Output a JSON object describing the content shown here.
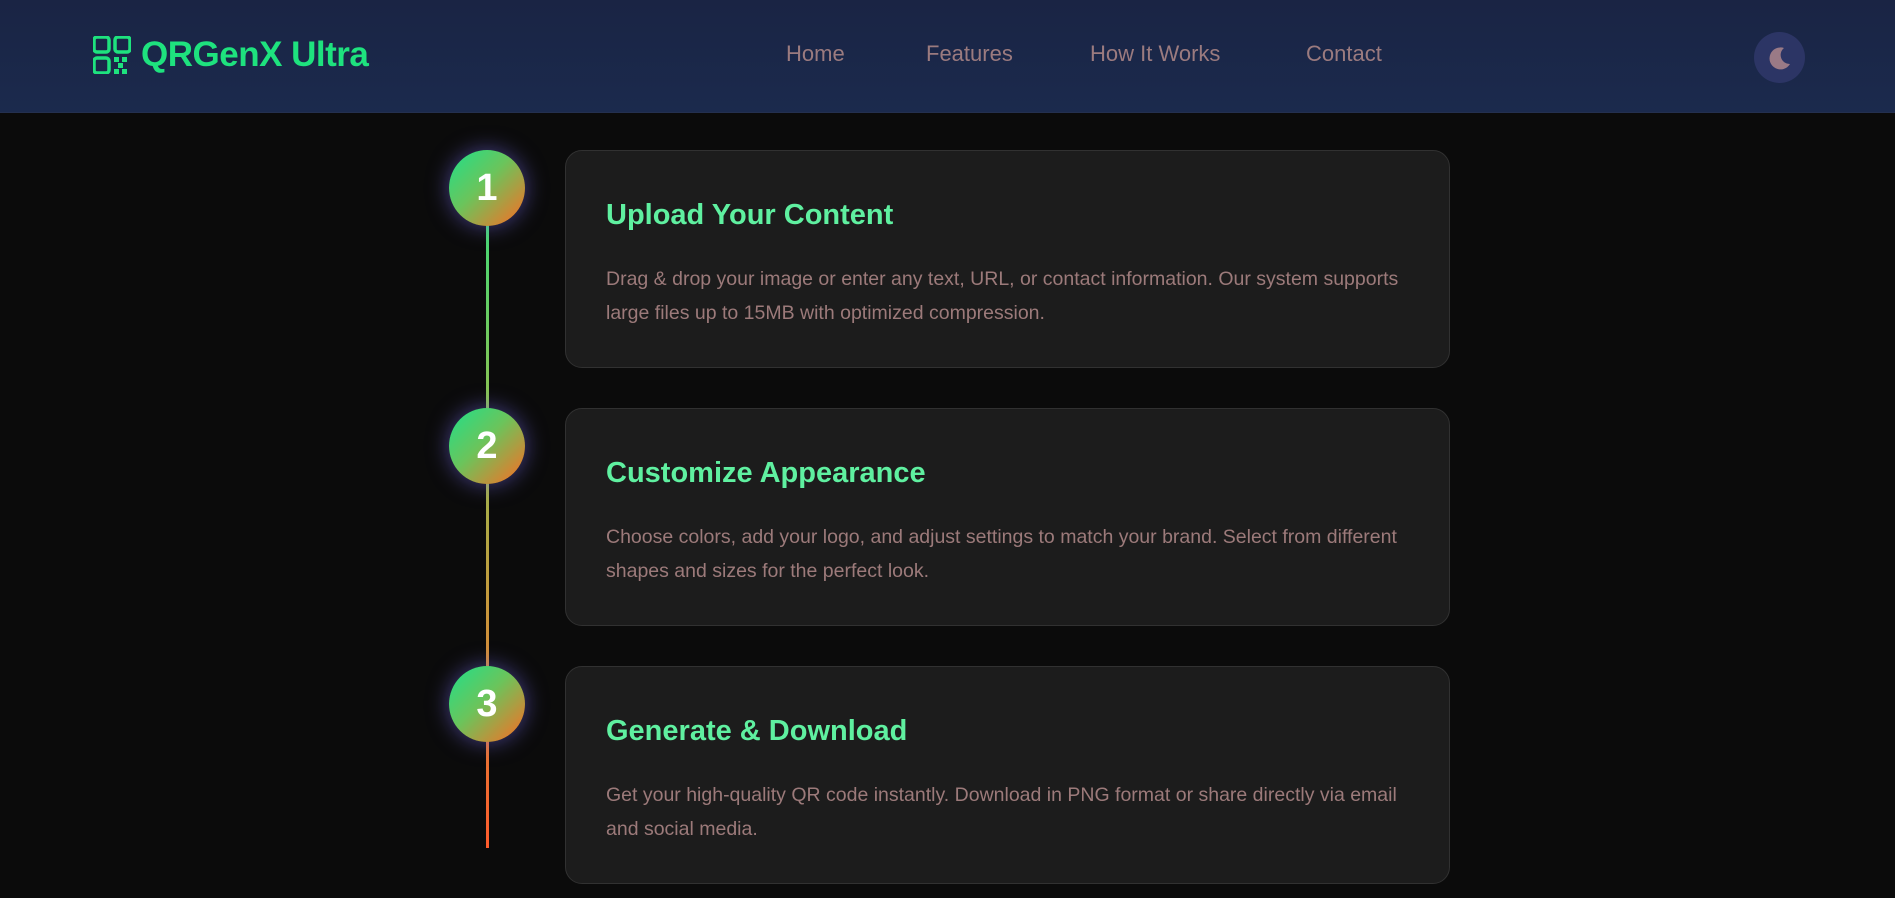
{
  "brand": {
    "name": "QRGenX Ultra",
    "icon": "qr-code-icon",
    "color": "#1ee27e"
  },
  "nav": {
    "links": [
      "Home",
      "Features",
      "How It Works",
      "Contact"
    ],
    "theme_toggle_icon": "moon-icon"
  },
  "colors": {
    "accent_green": "#1ee27e",
    "step_title": "#5ff0a0",
    "muted_text": "#9b7b7f",
    "gradient_end": "#ff6a22"
  },
  "steps": [
    {
      "number": "1",
      "title": "Upload Your Content",
      "description": "Drag & drop your image or enter any text, URL, or contact information. Our system supports large files up to 15MB with optimized compression."
    },
    {
      "number": "2",
      "title": "Customize Appearance",
      "description": "Choose colors, add your logo, and adjust settings to match your brand. Select from different shapes and sizes for the perfect look."
    },
    {
      "number": "3",
      "title": "Generate & Download",
      "description": "Get your high-quality QR code instantly. Download in PNG format or share directly via email and social media."
    }
  ]
}
